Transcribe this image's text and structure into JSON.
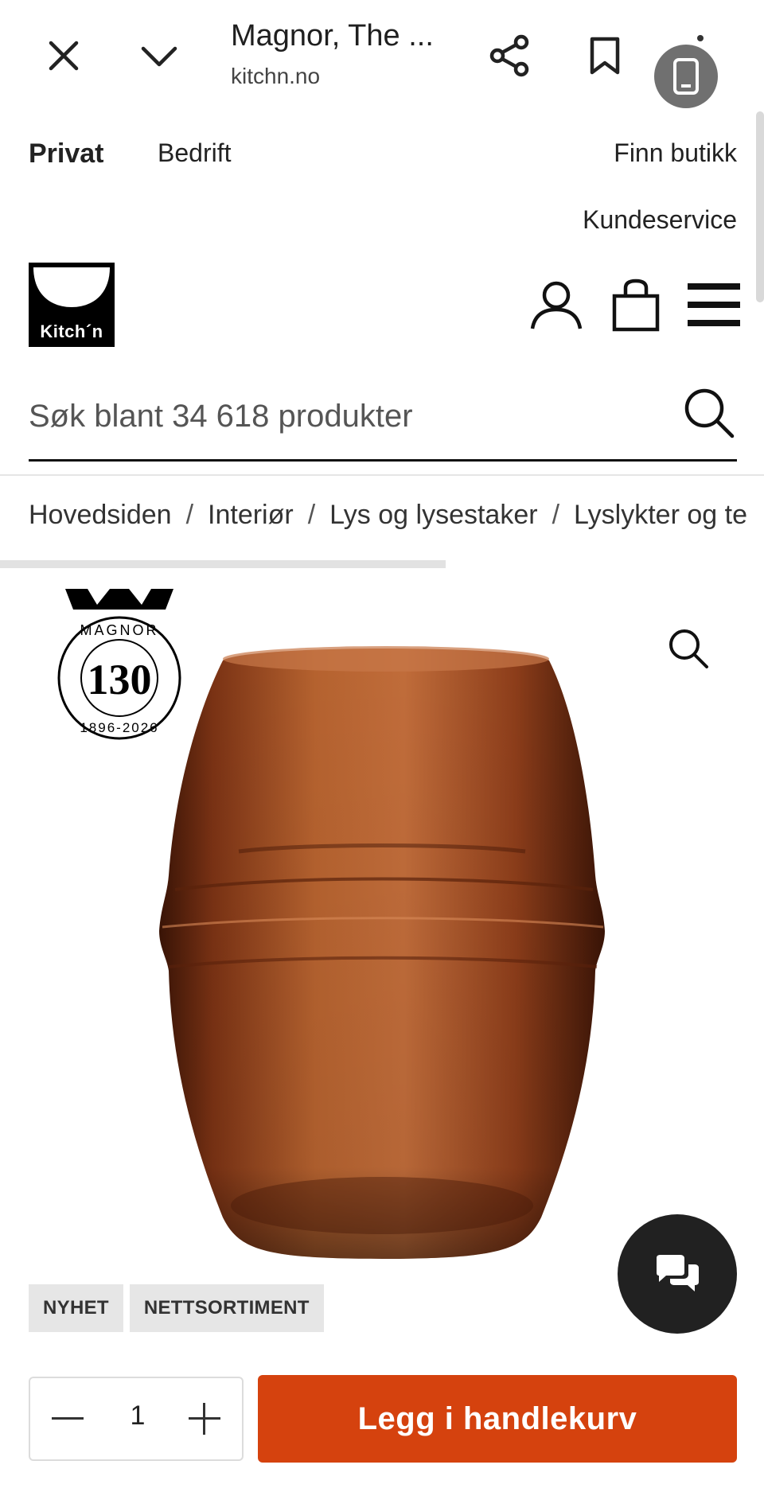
{
  "browser": {
    "title": "Magnor, The ...",
    "url": "kitchn.no"
  },
  "top_links": {
    "privat": "Privat",
    "bedrift": "Bedrift",
    "finn_butikk": "Finn butikk",
    "kundeservice": "Kundeservice"
  },
  "header": {
    "logo_text": "Kitch´n"
  },
  "search": {
    "placeholder": "Søk blant 34 618 produkter"
  },
  "breadcrumb": {
    "items": [
      "Hovedsiden",
      "Interiør",
      "Lys og lysestaker",
      "Lyslykter og te"
    ],
    "separator": "/"
  },
  "product": {
    "badge": {
      "brand": "MAGNOR",
      "number": "130",
      "years": "1896-2026"
    },
    "tags": [
      "NYHET",
      "NETTSORTIMENT"
    ],
    "glass_color": "#a8502a"
  },
  "cart": {
    "quantity": "1",
    "add_label": "Legg i handlekurv",
    "accent": "#d5420e"
  }
}
